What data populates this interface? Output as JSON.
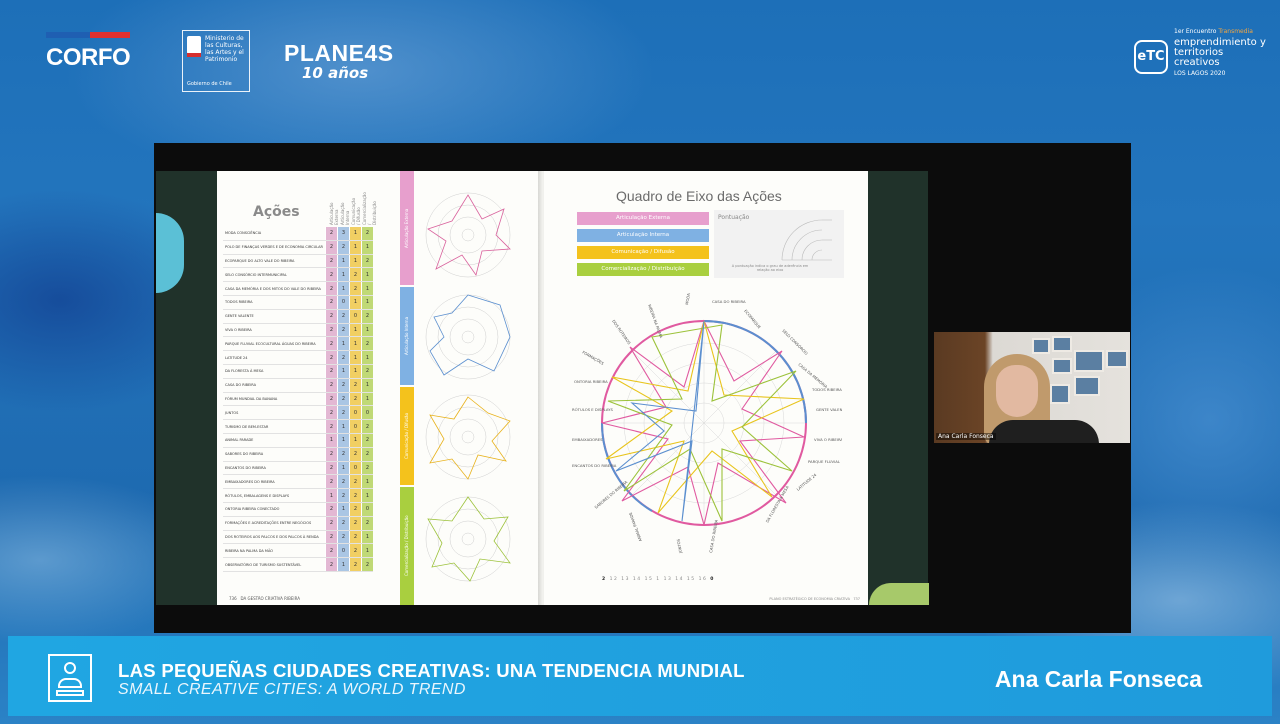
{
  "header": {
    "corfo": "CORFO",
    "ministerio": "Ministerio de las Culturas, las Artes y el Patrimonio",
    "gobierno": "Gobierno de Chile",
    "planes": "PLANE4S",
    "planes_sub": "10 años",
    "etc_badge": "eTC",
    "etc_small": "1er Encuentro",
    "etc_small_accent": "Transmedia",
    "etc_title": "emprendimiento y territorios creativos",
    "etc_place": "LOS LAGOS 2020",
    "colors": {
      "corfo_blue": "#1f5fb2",
      "corfo_red": "#e1302f",
      "accent": "#f4a640"
    }
  },
  "slide": {
    "left_title": "Ações",
    "column_headers": [
      "Articulação Externa",
      "Articulação Interna",
      "Comunicação / Difusão",
      "Comercialização / Distribuição"
    ],
    "actions": [
      {
        "name": "MODA CONSCIÊNCIA",
        "v": [
          "2",
          "3",
          "1",
          "2"
        ]
      },
      {
        "name": "POLO DE FINANÇAS VERDES E DE ECONOMIA CIRCULAR",
        "v": [
          "2",
          "2",
          "1",
          "1"
        ]
      },
      {
        "name": "ECOPARQUE DO ALTO VALE DO RIBEIRA",
        "v": [
          "2",
          "1",
          "1",
          "2"
        ]
      },
      {
        "name": "SELO CONSÓRCIO INTERMUNICIPAL",
        "v": [
          "2",
          "1",
          "2",
          "1"
        ]
      },
      {
        "name": "CASA DA MEMÓRIA E DOS MITOS DO VALE DO RIBEIRA",
        "v": [
          "2",
          "1",
          "2",
          "1"
        ]
      },
      {
        "name": "TODOS RIBEIRA",
        "v": [
          "2",
          "0",
          "1",
          "1"
        ]
      },
      {
        "name": "GENTE VALENTE",
        "v": [
          "2",
          "2",
          "0",
          "2"
        ]
      },
      {
        "name": "VIVA O RIBEIRA",
        "v": [
          "2",
          "2",
          "1",
          "1"
        ]
      },
      {
        "name": "PARQUE FLUVIAL ECOCULTURAL ÁGUAS DO RIBEIRA",
        "v": [
          "2",
          "1",
          "1",
          "2"
        ]
      },
      {
        "name": "LATITUDE 24",
        "v": [
          "2",
          "2",
          "1",
          "1"
        ]
      },
      {
        "name": "DA FLORESTA À MESA",
        "v": [
          "2",
          "1",
          "1",
          "2"
        ]
      },
      {
        "name": "CASA DO RIBEIRA",
        "v": [
          "2",
          "2",
          "2",
          "1"
        ]
      },
      {
        "name": "FÓRUM MUNDIAL DA BANANA",
        "v": [
          "2",
          "2",
          "2",
          "1"
        ]
      },
      {
        "name": "JUNTOS",
        "v": [
          "2",
          "2",
          "0",
          "0"
        ]
      },
      {
        "name": "TURISMO DE BEM-ESTAR",
        "v": [
          "2",
          "1",
          "0",
          "2"
        ]
      },
      {
        "name": "ANIMAL PARADE",
        "v": [
          "1",
          "1",
          "1",
          "2"
        ]
      },
      {
        "name": "SABORES DO RIBEIRA",
        "v": [
          "2",
          "2",
          "2",
          "2"
        ]
      },
      {
        "name": "ENCANTOS DO RIBEIRA",
        "v": [
          "2",
          "1",
          "0",
          "2"
        ]
      },
      {
        "name": "EMBAIXADORES DO RIBEIRA",
        "v": [
          "2",
          "2",
          "2",
          "1"
        ]
      },
      {
        "name": "RÓTULOS, EMBALAGENS E DISPLAYS",
        "v": [
          "1",
          "2",
          "2",
          "1"
        ]
      },
      {
        "name": "ONTORIA RIBEIRA CONECTADO",
        "v": [
          "2",
          "1",
          "2",
          "0"
        ]
      },
      {
        "name": "FORMAÇÕES E ACREDITAÇÕES ENTRE NEGÓCIOS",
        "v": [
          "2",
          "2",
          "2",
          "2"
        ]
      },
      {
        "name": "DOS ROTEIROS AOS PALCOS E DOS PALCOS À RENDA",
        "v": [
          "2",
          "2",
          "2",
          "1"
        ]
      },
      {
        "name": "RIBEIRA NA PALMA DA MÃO",
        "v": [
          "2",
          "0",
          "2",
          "1"
        ]
      },
      {
        "name": "OBSERVATÓRIO DE TURISMO SUSTENTÁVEL",
        "v": [
          "2",
          "1",
          "2",
          "2"
        ]
      }
    ],
    "bands": [
      "Articulação Externa",
      "Articulação Interna",
      "Comunicação / Difusão",
      "Comercialização / Distribuição"
    ],
    "page_left": "736",
    "page_left_caption": "DA GESTÃO CRIATIVA RIBEIRA",
    "right_title": "Quadro de Eixo das Ações",
    "legend": [
      {
        "label": "Articulação Externa",
        "color": "#e79fcd"
      },
      {
        "label": "Articulação Interna",
        "color": "#7fb1e3"
      },
      {
        "label": "Comunicação / Difusão",
        "color": "#f4c21c"
      },
      {
        "label": "Comercialização / Distribuição",
        "color": "#a9cf3f"
      }
    ],
    "pontuacao": "Pontuação",
    "pontuacao_note": "A pontuação indica o grau de aderência em relação ao eixo",
    "scale": [
      "2",
      "12",
      "13",
      "14",
      "15",
      "1",
      "13",
      "14",
      "15",
      "16",
      "0"
    ],
    "page_right": "737",
    "page_right_caption": "PLANO ESTRATÉGICO DE ECONOMIA CRIATIVA"
  },
  "webcam": {
    "name": "Ana Carla Fonseca"
  },
  "lower_third": {
    "title_es": "LAS PEQUEÑAS CIUDADES CREATIVAS: UNA TENDENCIA MUNDIAL",
    "title_en": "SMALL CREATIVE CITIES: A WORLD TREND",
    "speaker": "Ana Carla Fonseca",
    "icon": "presenter-podium-icon"
  }
}
